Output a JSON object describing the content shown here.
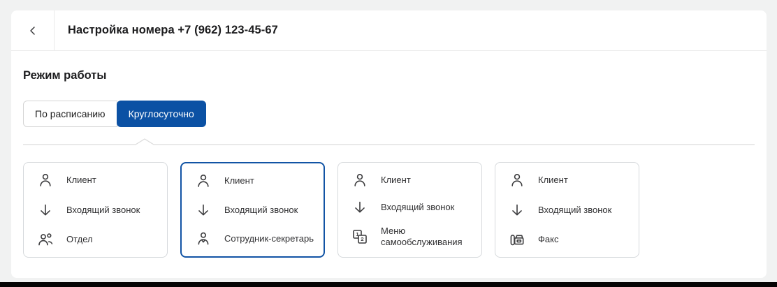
{
  "colors": {
    "accent": "#0b51a4",
    "selected_card_border": "#1254a5",
    "background": "#f1f2f2"
  },
  "header": {
    "back_icon": "chevron-left",
    "title": "Настройка номера +7 (962) 123-45-67"
  },
  "section_title": "Режим работы",
  "tabs": [
    {
      "label": "По расписанию",
      "selected": false
    },
    {
      "label": "Круглосуточно",
      "selected": true
    }
  ],
  "scheme_cards": [
    {
      "selected": false,
      "rows": [
        {
          "icon": "person",
          "label": "Клиент"
        },
        {
          "icon": "arrow-down",
          "label": "Входящий звонок"
        },
        {
          "icon": "people",
          "label": "Отдел"
        }
      ]
    },
    {
      "selected": true,
      "rows": [
        {
          "icon": "person",
          "label": "Клиент"
        },
        {
          "icon": "arrow-down",
          "label": "Входящий звонок"
        },
        {
          "icon": "person-secretary",
          "label": "Сотрудник-секретарь"
        }
      ]
    },
    {
      "selected": false,
      "rows": [
        {
          "icon": "person",
          "label": "Клиент"
        },
        {
          "icon": "arrow-down",
          "label": "Входящий звонок"
        },
        {
          "icon": "menu-selfservice",
          "label": "Меню самообслуживания"
        }
      ]
    },
    {
      "selected": false,
      "rows": [
        {
          "icon": "person",
          "label": "Клиент"
        },
        {
          "icon": "arrow-down",
          "label": "Входящий звонок"
        },
        {
          "icon": "fax",
          "label": "Факс"
        }
      ]
    }
  ]
}
